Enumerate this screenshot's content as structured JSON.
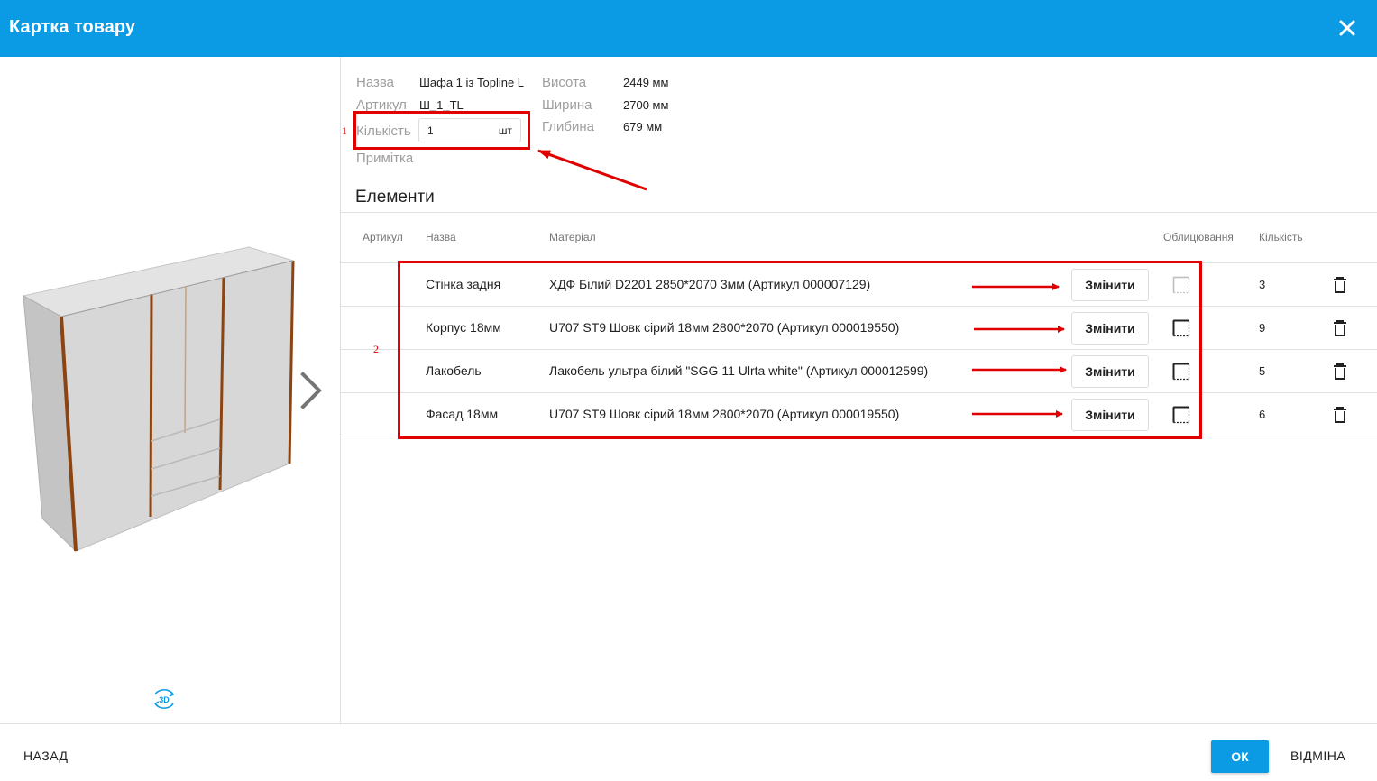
{
  "dialog": {
    "title": "Картка товару"
  },
  "icons": {
    "close": "close-icon",
    "next": "chevron-right-icon",
    "view3d": "3d-rotate-icon",
    "edge": "edge-banding-icon",
    "delete": "trash-icon"
  },
  "colors": {
    "header": "#0a9be4",
    "accent": "#0a9be4",
    "annotation": "#e00000"
  },
  "product": {
    "name_label": "Назва",
    "name_value": "Шафа 1 із Topline L",
    "sku_label": "Артикул",
    "sku_value": "Ш_1_TL",
    "qty_label": "Кількість",
    "qty_value": "1",
    "qty_unit": "шт",
    "note_label": "Примітка",
    "height_label": "Висота",
    "height_value": "2449 мм",
    "width_label": "Ширина",
    "width_value": "2700 мм",
    "depth_label": "Глибина",
    "depth_value": "679 мм"
  },
  "elements": {
    "title": "Елементи",
    "columns": {
      "sku": "Артикул",
      "name": "Назва",
      "material": "Матеріал",
      "edging": "Облицювання",
      "qty": "Кількість"
    },
    "change_label": "Змінити",
    "rows": [
      {
        "name": "Стінка задня",
        "material": "ХДФ Білий D2201 2850*2070 3мм (Артикул 000007129)",
        "qty": "3",
        "edge_active": false
      },
      {
        "name": "Корпус 18мм",
        "material": "U707 ST9 Шовк сірий 18мм 2800*2070 (Артикул 000019550)",
        "qty": "9",
        "edge_active": true
      },
      {
        "name": "Лакобель",
        "material": "Лакобель ультра білий \"SGG 11 Ulrta white\" (Артикул 000012599)",
        "qty": "5",
        "edge_active": true
      },
      {
        "name": "Фасад 18мм",
        "material": "U707 ST9 Шовк сірий 18мм 2800*2070 (Артикул 000019550)",
        "qty": "6",
        "edge_active": true
      }
    ]
  },
  "annotations": {
    "marker1": "1",
    "marker2": "2"
  },
  "footer": {
    "back": "НАЗАД",
    "ok": "ОК",
    "cancel": "ВІДМІНА"
  }
}
